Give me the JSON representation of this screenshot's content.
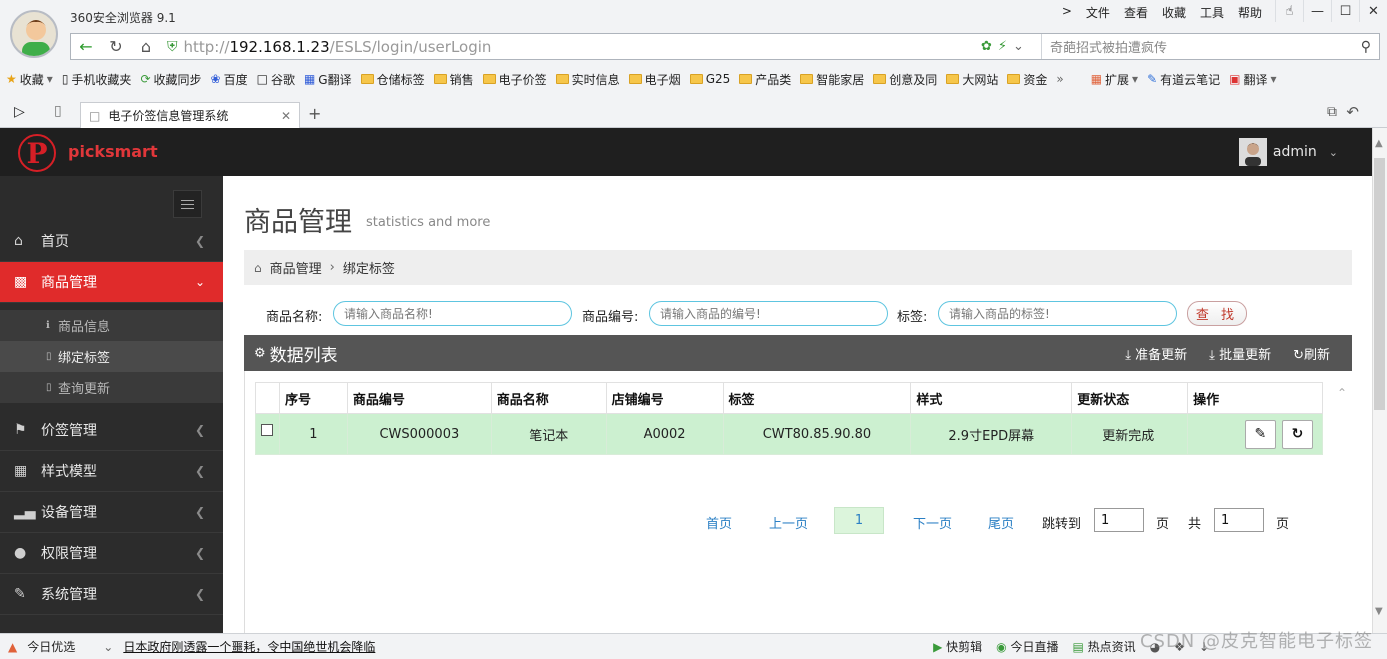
{
  "browser": {
    "title": "360安全浏览器 9.1",
    "menus": [
      "文件",
      "查看",
      "收藏",
      "工具",
      "帮助"
    ],
    "url_scheme": "http://",
    "url_host": "192.168.1.23",
    "url_path": "/ESLS/login/userLogin",
    "search_placeholder": "奇葩招式被拍遭疯传",
    "bookmarks": [
      "收藏",
      "手机收藏夹",
      "收藏同步",
      "百度",
      "谷歌",
      "G翻译",
      "仓储标签",
      "销售",
      "电子价签",
      "实时信息",
      "电子烟",
      "G25",
      "产品类",
      "智能家居",
      "创意及同",
      "大网站",
      "资金"
    ],
    "extensions": [
      "扩展",
      "有道云笔记",
      "翻译"
    ],
    "tab_title": "电子价签信息管理系统"
  },
  "header": {
    "logo_letter": "P",
    "brand": "picksmart",
    "username": "admin"
  },
  "sidebar": {
    "items": [
      {
        "label": "首页",
        "icon": "home-icon"
      },
      {
        "label": "商品管理",
        "icon": "folder-icon",
        "active": true
      },
      {
        "label": "价签管理",
        "icon": "tags-icon"
      },
      {
        "label": "样式模型",
        "icon": "grid-icon"
      },
      {
        "label": "设备管理",
        "icon": "signal-icon"
      },
      {
        "label": "权限管理",
        "icon": "user-icon"
      },
      {
        "label": "系统管理",
        "icon": "edit-icon"
      }
    ],
    "subitems": [
      {
        "label": "商品信息"
      },
      {
        "label": "绑定标签",
        "active": true
      },
      {
        "label": "查询更新"
      }
    ]
  },
  "page": {
    "title": "商品管理",
    "subtitle": "statistics and more",
    "breadcrumb_1": "商品管理",
    "breadcrumb_2": "绑定标签"
  },
  "search": {
    "name_label": "商品名称:",
    "name_placeholder": "请输入商品名称!",
    "code_label": "商品编号:",
    "code_placeholder": "请输入商品的编号!",
    "tag_label": "标签:",
    "tag_placeholder": "请输入商品的标签!",
    "button": "查 找"
  },
  "panel": {
    "title": "数据列表",
    "actions": [
      "准备更新",
      "批量更新",
      "刷新"
    ]
  },
  "table": {
    "headers": [
      "",
      "序号",
      "商品编号",
      "商品名称",
      "店铺编号",
      "标签",
      "样式",
      "更新状态",
      "操作"
    ],
    "rows": [
      {
        "index": "1",
        "code": "CWS000003",
        "name": "笔记本",
        "shop": "A0002",
        "tag": "CWT80.85.90.80",
        "style": "2.9寸EPD屏幕",
        "status": "更新完成"
      }
    ]
  },
  "pager": {
    "first": "首页",
    "prev": "上一页",
    "current": "1",
    "next": "下一页",
    "last": "尾页",
    "goto_label": "跳转到",
    "goto_value": "1",
    "page_unit": "页",
    "total_label": "共",
    "total_value": "1",
    "total_unit": "页"
  },
  "statusbar": {
    "left": "今日优选",
    "news": "日本政府刚透露一个噩耗，令中国绝世机会降临",
    "right": [
      "快剪辑",
      "今日直播",
      "热点资讯"
    ],
    "watermark": "CSDN @皮克智能电子标签"
  },
  "colors": {
    "header_bg": "#1f1f1f",
    "sidebar_bg": "#2c2c2c",
    "active_red": "#e02b2b",
    "row_green": "#ccf0d0",
    "status_green": "#1a9e1a"
  }
}
